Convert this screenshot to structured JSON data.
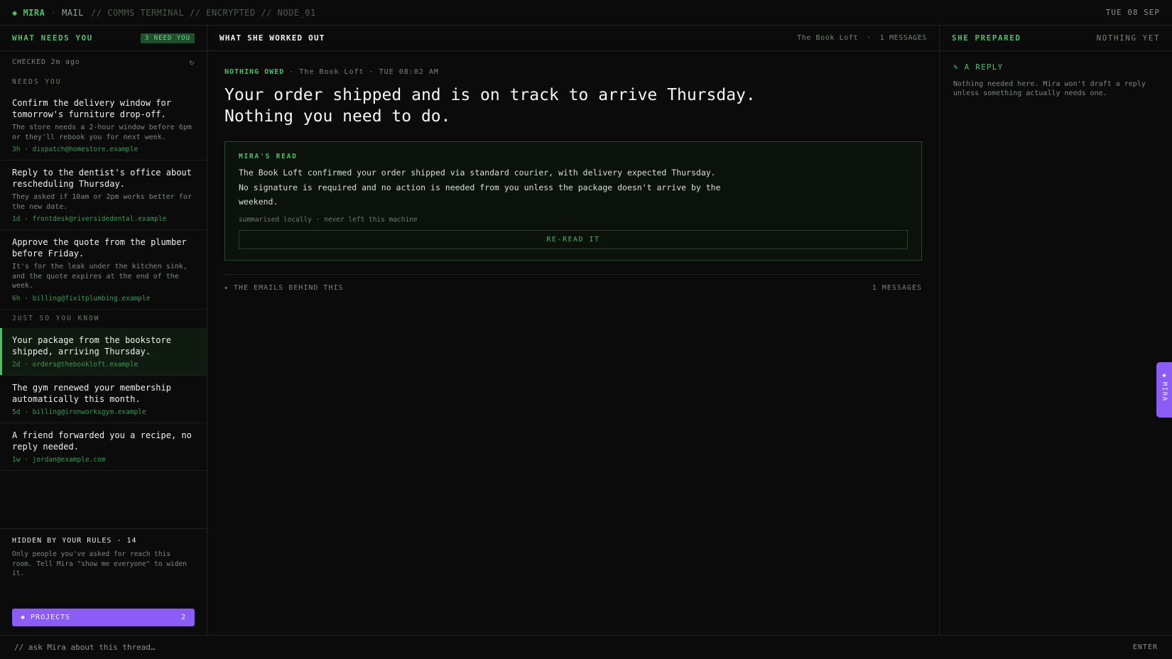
{
  "topbar": {
    "brand": "◆ MIRA",
    "separator": "·",
    "mail": "MAIL",
    "path": "// COMMS TERMINAL // ENCRYPTED // NODE_01",
    "date": "TUE 08 SEP"
  },
  "sidebar": {
    "title": "WHAT NEEDS YOU",
    "badge": "3 NEED YOU",
    "checked": "CHECKED 2m ago",
    "refresh": "↻",
    "needs_you_label": "NEEDS YOU",
    "needs_you": [
      {
        "subject": "Confirm the delivery window for tomorrow's furniture drop-off.",
        "snippet": "The store needs a 2-hour window before 6pm or they'll rebook you for next week.",
        "meta": "3h · dispatch@homestore.example"
      },
      {
        "subject": "Reply to the dentist's office about rescheduling Thursday.",
        "snippet": "They asked if 10am or 2pm works better for the new date.",
        "meta": "1d · frontdesk@riversidedental.example"
      },
      {
        "subject": "Approve the quote from the plumber before Friday.",
        "snippet": "It's for the leak under the kitchen sink, and the quote expires at the end of the week.",
        "meta": "6h · billing@fixitplumbing.example"
      }
    ],
    "fyi_label": "JUST SO YOU KNOW",
    "fyi": [
      {
        "subject": "Your package from the bookstore shipped, arriving Thursday.",
        "meta": "2d · orders@thebookloft.example"
      },
      {
        "subject": "The gym renewed your membership automatically this month.",
        "meta": "5d · billing@ironworksgym.example"
      },
      {
        "subject": "A friend forwarded you a recipe, no reply needed.",
        "meta": "1w · jordan@example.com"
      }
    ],
    "hidden_title": "HIDDEN BY YOUR RULES · 14",
    "hidden_text": "Only people you've asked for reach this room. Tell Mira \"show me everyone\" to widen it.",
    "projects_label": "◆ PROJECTS",
    "projects_count": "2"
  },
  "main": {
    "title": "WHAT SHE WORKED OUT",
    "sender": "The Book Loft",
    "dot": "·",
    "messages": "1 MESSAGES",
    "status_tag": "NOTHING OWED",
    "status_rest": " · The Book Loft · TUE 08:02 AM",
    "headline": "Your order shipped and is on track to arrive Thursday. Nothing you need to do.",
    "read_label": "MIRA'S READ",
    "read_text": "The Book Loft confirmed your order shipped via standard courier, with delivery expected Thursday. No signature is required and no action is needed from you unless the package doesn't arrive by the weekend.",
    "read_note": "summarised locally · never left this machine",
    "reread_label": "RE-READ IT",
    "emails_arrow": "▸",
    "emails_label": "THE EMAILS BEHIND THIS",
    "emails_count": "1 MESSAGES"
  },
  "prepared": {
    "title": "SHE PREPARED",
    "status": "NOTHING YET",
    "reply_label": "✎ A REPLY",
    "reply_text": "Nothing needed here. Mira won't draft a reply unless something actually needs one."
  },
  "mira_tab": {
    "icon": "◆",
    "label": "MIRA"
  },
  "prompt": {
    "placeholder": "// ask Mira about this thread…",
    "enter": "ENTER"
  }
}
